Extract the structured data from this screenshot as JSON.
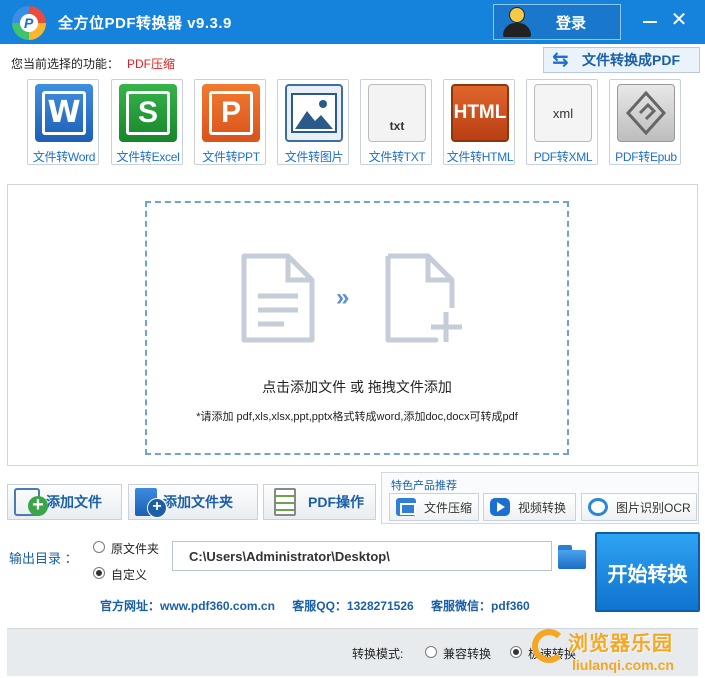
{
  "window": {
    "title": "全方位PDF转换器 v9.3.9",
    "logo_letter": "P",
    "login_label": "登录",
    "close_glyph": "✕"
  },
  "function": {
    "label": "您当前选择的功能：",
    "value": "PDF压缩",
    "mode_switch_label": "文件转换成PDF"
  },
  "tools": [
    {
      "label": "文件转Word",
      "glyph": "W"
    },
    {
      "label": "文件转Excel",
      "glyph": "S"
    },
    {
      "label": "文件转PPT",
      "glyph": "P"
    },
    {
      "label": "文件转图片",
      "glyph": ""
    },
    {
      "label": "文件转TXT",
      "glyph": "txt"
    },
    {
      "label": "文件转HTML",
      "glyph": "HTML"
    },
    {
      "label": "PDF转XML",
      "glyph": "xml"
    },
    {
      "label": "PDF转Epub",
      "glyph": "e"
    }
  ],
  "drop_zone": {
    "arrows": "»",
    "title": "点击添加文件 或 拖拽文件添加",
    "hint": "*请添加 pdf,xls,xlsx,ppt,pptx格式转成word,添加doc,docx可转成pdf"
  },
  "actions": {
    "add_file": "添加文件",
    "add_folder": "添加文件夹",
    "pdf_ops": "PDF操作"
  },
  "featured": {
    "title": "特色产品推荐",
    "items": [
      "文件压缩",
      "视频转换",
      "图片识别OCR"
    ]
  },
  "output": {
    "label": "输出目录 ：",
    "option_source": "原文件夹",
    "option_custom": "自定义",
    "selected": "custom",
    "path": "C:\\Users\\Administrator\\Desktop\\",
    "start_label": "开始转换"
  },
  "contact": {
    "website": "官方网址：www.pdf360.com.cn",
    "qq": "客服QQ：1328271526",
    "wechat": "客服微信：pdf360"
  },
  "bottom": {
    "mode_label": "转换模式:",
    "mode_compat": "兼容转换",
    "mode_fast": "极速转换",
    "selected": "fast"
  },
  "watermark": {
    "title": "浏览器乐园",
    "url": "liulanqi.com.cn",
    "color": "#f5a623"
  },
  "colors": {
    "titlebar": "#1583dc",
    "accent": "#1a6fd0",
    "highlight": "#e02020"
  }
}
